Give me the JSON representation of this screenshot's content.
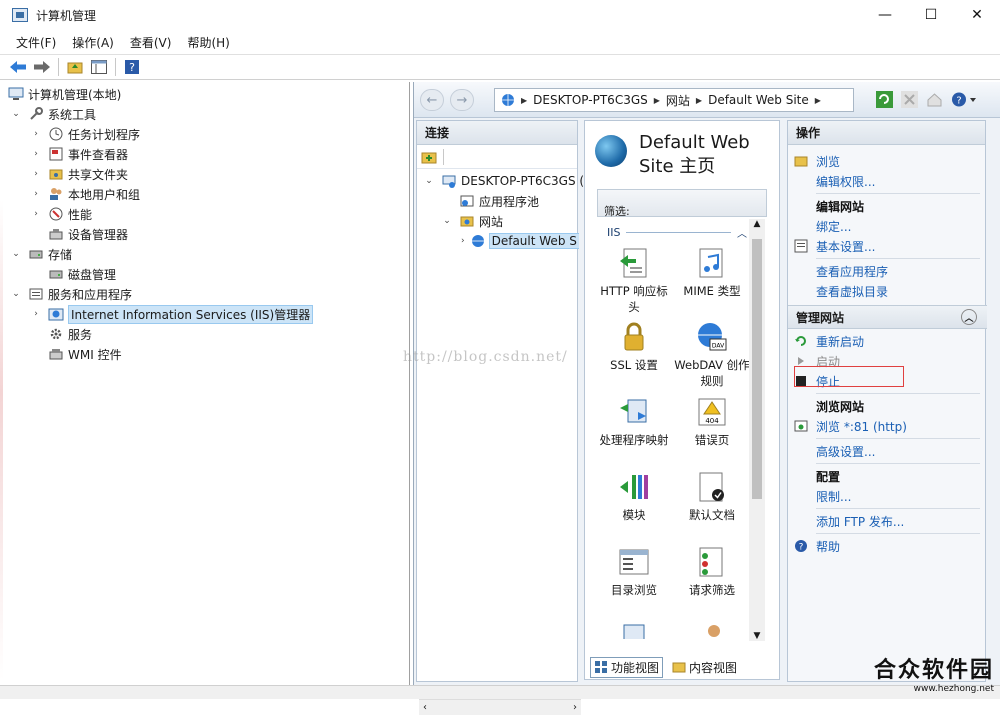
{
  "window": {
    "title": "计算机管理",
    "min": "—",
    "max": "☐",
    "close": "✕"
  },
  "menu": [
    "文件(F)",
    "操作(A)",
    "查看(V)",
    "帮助(H)"
  ],
  "tree": [
    {
      "label": "计算机管理(本地)",
      "exp": "",
      "icon": "computer-management-icon",
      "level": 0
    },
    {
      "label": "系统工具",
      "exp": "⌄",
      "icon": "system-tools-icon",
      "level": 1
    },
    {
      "label": "任务计划程序",
      "exp": "›",
      "icon": "task-scheduler-icon",
      "level": 2
    },
    {
      "label": "事件查看器",
      "exp": "›",
      "icon": "event-viewer-icon",
      "level": 2
    },
    {
      "label": "共享文件夹",
      "exp": "›",
      "icon": "shared-folders-icon",
      "level": 2
    },
    {
      "label": "本地用户和组",
      "exp": "›",
      "icon": "local-users-icon",
      "level": 2
    },
    {
      "label": "性能",
      "exp": "›",
      "icon": "performance-icon",
      "level": 2
    },
    {
      "label": "设备管理器",
      "exp": "",
      "icon": "device-manager-icon",
      "level": 2
    },
    {
      "label": "存储",
      "exp": "⌄",
      "icon": "storage-icon",
      "level": 1
    },
    {
      "label": "磁盘管理",
      "exp": "",
      "icon": "disk-management-icon",
      "level": 2
    },
    {
      "label": "服务和应用程序",
      "exp": "⌄",
      "icon": "services-apps-icon",
      "level": 1
    },
    {
      "label": "Internet Information Services (IIS)管理器",
      "exp": "›",
      "icon": "iis-icon",
      "level": 2,
      "selected": true
    },
    {
      "label": "服务",
      "exp": "",
      "icon": "services-icon",
      "level": 2
    },
    {
      "label": "WMI 控件",
      "exp": "",
      "icon": "wmi-icon",
      "level": 2
    }
  ],
  "address": {
    "parts": [
      "DESKTOP-PT6C3GS",
      "网站",
      "Default Web Site"
    ]
  },
  "connections": {
    "title": "连接",
    "nodes": [
      {
        "label": "DESKTOP-PT6C3GS (",
        "exp": "⌄",
        "level": 0
      },
      {
        "label": "应用程序池",
        "exp": "",
        "level": 1
      },
      {
        "label": "网站",
        "exp": "⌄",
        "level": 1
      },
      {
        "label": "Default Web S",
        "exp": "›",
        "level": 2,
        "selected": true
      }
    ]
  },
  "home": {
    "title_line1": "Default Web",
    "title_line2": "Site 主页",
    "filter_label": "筛选:",
    "section": "IIS",
    "features": [
      {
        "label": "HTTP 响应标头",
        "icon": "http-response-headers-icon"
      },
      {
        "label": "MIME 类型",
        "icon": "mime-types-icon"
      },
      {
        "label": "SSL 设置",
        "icon": "ssl-lock-icon"
      },
      {
        "label": "WebDAV 创作规则",
        "icon": "webdav-icon"
      },
      {
        "label": "处理程序映射",
        "icon": "handler-mappings-icon"
      },
      {
        "label": "错误页",
        "icon": "error-pages-icon"
      },
      {
        "label": "模块",
        "icon": "modules-icon"
      },
      {
        "label": "默认文档",
        "icon": "default-document-icon"
      },
      {
        "label": "目录浏览",
        "icon": "directory-browsing-icon"
      },
      {
        "label": "请求筛选",
        "icon": "request-filtering-icon"
      }
    ],
    "view_features": "功能视图",
    "view_content": "内容视图"
  },
  "actions": {
    "title": "操作",
    "browse": "浏览",
    "edit_permissions": "编辑权限...",
    "edit_site": "编辑网站",
    "bindings": "绑定...",
    "basic_settings": "基本设置...",
    "view_apps": "查看应用程序",
    "view_vdirs": "查看虚拟目录",
    "manage_site": "管理网站",
    "restart": "重新启动",
    "start": "启动",
    "stop": "停止",
    "browse_site": "浏览网站",
    "browse_81": "浏览 *:81 (http)",
    "advanced": "高级设置...",
    "config": "配置",
    "limits": "限制...",
    "add_ftp": "添加 FTP 发布...",
    "help": "帮助"
  },
  "watermark": "http://blog.csdn.net/",
  "brand": {
    "name": "合众软件园",
    "url": "www.hezhong.net"
  },
  "colors": {
    "link": "#1a5fb4",
    "highlight_box": "#e04040",
    "selection": "#cce4f7"
  }
}
